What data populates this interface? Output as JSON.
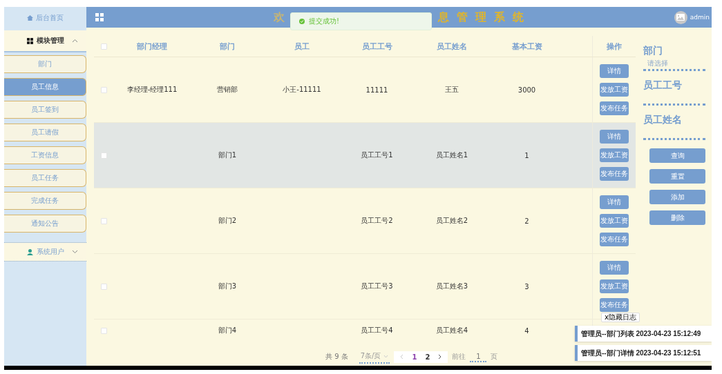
{
  "sidebar": {
    "home": "后台首页",
    "menus": [
      {
        "label": "模块管理",
        "expanded": true,
        "items": [
          {
            "label": "部门",
            "selected": false
          },
          {
            "label": "员工信息",
            "selected": true
          },
          {
            "label": "员工签到",
            "selected": false
          },
          {
            "label": "员工请假",
            "selected": false
          },
          {
            "label": "工资信息",
            "selected": false
          },
          {
            "label": "员工任务",
            "selected": false
          },
          {
            "label": "完成任务",
            "selected": false
          },
          {
            "label": "通知公告",
            "selected": false
          }
        ]
      },
      {
        "label": "系统用户",
        "expanded": false
      }
    ]
  },
  "header": {
    "title_start": "欢",
    "title_end": "息管理系统",
    "user": "admin"
  },
  "toast": {
    "message": "提交成功!"
  },
  "table": {
    "select_all_checked": false,
    "columns": [
      "部门经理",
      "部门",
      "员工",
      "员工工号",
      "员工姓名",
      "基本工资"
    ],
    "action_column": "操作",
    "rows": [
      {
        "hovered": false,
        "checked": false,
        "cells": [
          "李经理-经理111",
          "营销部",
          "小王-11111",
          "11111",
          "王五",
          "3000"
        ],
        "actions": [
          "详情",
          "发放工资",
          "发布任务"
        ]
      },
      {
        "hovered": true,
        "checked": false,
        "cells": [
          null,
          "部门1",
          null,
          "员工工号1",
          "员工姓名1",
          "1"
        ],
        "actions": [
          "详情",
          "发放工资",
          "发布任务"
        ]
      },
      {
        "hovered": false,
        "checked": false,
        "cells": [
          null,
          "部门2",
          null,
          "员工工号2",
          "员工姓名2",
          "2"
        ],
        "actions": [
          "详情",
          "发放工资",
          "发布任务"
        ]
      },
      {
        "hovered": false,
        "checked": false,
        "cells": [
          null,
          "部门3",
          null,
          "员工工号3",
          "员工姓名3",
          "3"
        ],
        "actions": [
          "详情",
          "发放工资",
          "发布任务"
        ]
      },
      {
        "hovered": false,
        "checked": false,
        "cells": [
          null,
          "部门4",
          null,
          "员工工号4",
          "员工姓名4",
          "4"
        ],
        "actions": []
      }
    ]
  },
  "pagination": {
    "total": "共 9 条",
    "page_size": "7条/页",
    "pages": [
      {
        "label": "1",
        "selected": true
      },
      {
        "label": "2",
        "selected": false
      }
    ],
    "goto_label": "前往",
    "goto_value": "1",
    "goto_suffix": "页"
  },
  "search_panel": {
    "fields": [
      {
        "label": "部门",
        "kind": "select",
        "placeholder": "请选择"
      },
      {
        "label": "员工工号",
        "kind": "input"
      },
      {
        "label": "员工姓名",
        "kind": "input"
      }
    ],
    "buttons": [
      "查询",
      "重置",
      "添加",
      "删除"
    ]
  },
  "log": {
    "toggle": "x隐藏日志",
    "entries": [
      "管理员--部门列表 2023-04-23 15:12:49",
      "管理员--部门详情 2023-04-23 15:12:51"
    ]
  }
}
